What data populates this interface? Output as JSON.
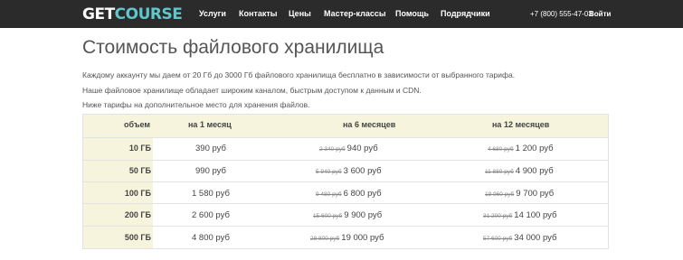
{
  "header": {
    "logo_part1": "GET",
    "logo_part2": "COURSE",
    "nav": [
      "Услуги",
      "Контакты",
      "Цены",
      "Мастер-классы",
      "Помощь",
      "Подрядчики"
    ],
    "phone": "+7 (800) 555-47-03",
    "login": "Войти"
  },
  "page": {
    "title": "Стоимость файлового хранилища",
    "paragraphs": [
      "Каждому аккаунту мы даем от 20 Гб до 3000 Гб файлового хранилища бесплатно в зависимости от выбранного тарифа.",
      "Наше файловое хранилище обладает широким каналом, быстрым доступом к данным и CDN.",
      "Ниже тарифы на дополнительное место для хранения файлов."
    ]
  },
  "table": {
    "headers": [
      "объем",
      "на 1 месяц",
      "на 6 месяцев",
      "на 12 месяцев"
    ],
    "rows": [
      {
        "volume": "10 ГБ",
        "m1": "390 руб",
        "m6_old": "2 340 руб",
        "m6": "940 руб",
        "m12_old": "4 680 руб",
        "m12": "1 200 руб"
      },
      {
        "volume": "50 ГБ",
        "m1": "990 руб",
        "m6_old": "5 940 руб",
        "m6": "3 600 руб",
        "m12_old": "11 880 руб",
        "m12": "4 900 руб"
      },
      {
        "volume": "100 ГБ",
        "m1": "1 580 руб",
        "m6_old": "9 480 руб",
        "m6": "6 800 руб",
        "m12_old": "18 960 руб",
        "m12": "9 700 руб"
      },
      {
        "volume": "200 ГБ",
        "m1": "2 600 руб",
        "m6_old": "15 600 руб",
        "m6": "9 900 руб",
        "m12_old": "31 200 руб",
        "m12": "14 100 руб"
      },
      {
        "volume": "500 ГБ",
        "m1": "4 800 руб",
        "m6_old": "28 800 руб",
        "m6": "19 000 руб",
        "m12_old": "57 600 руб",
        "m12": "34 000 руб"
      }
    ]
  }
}
